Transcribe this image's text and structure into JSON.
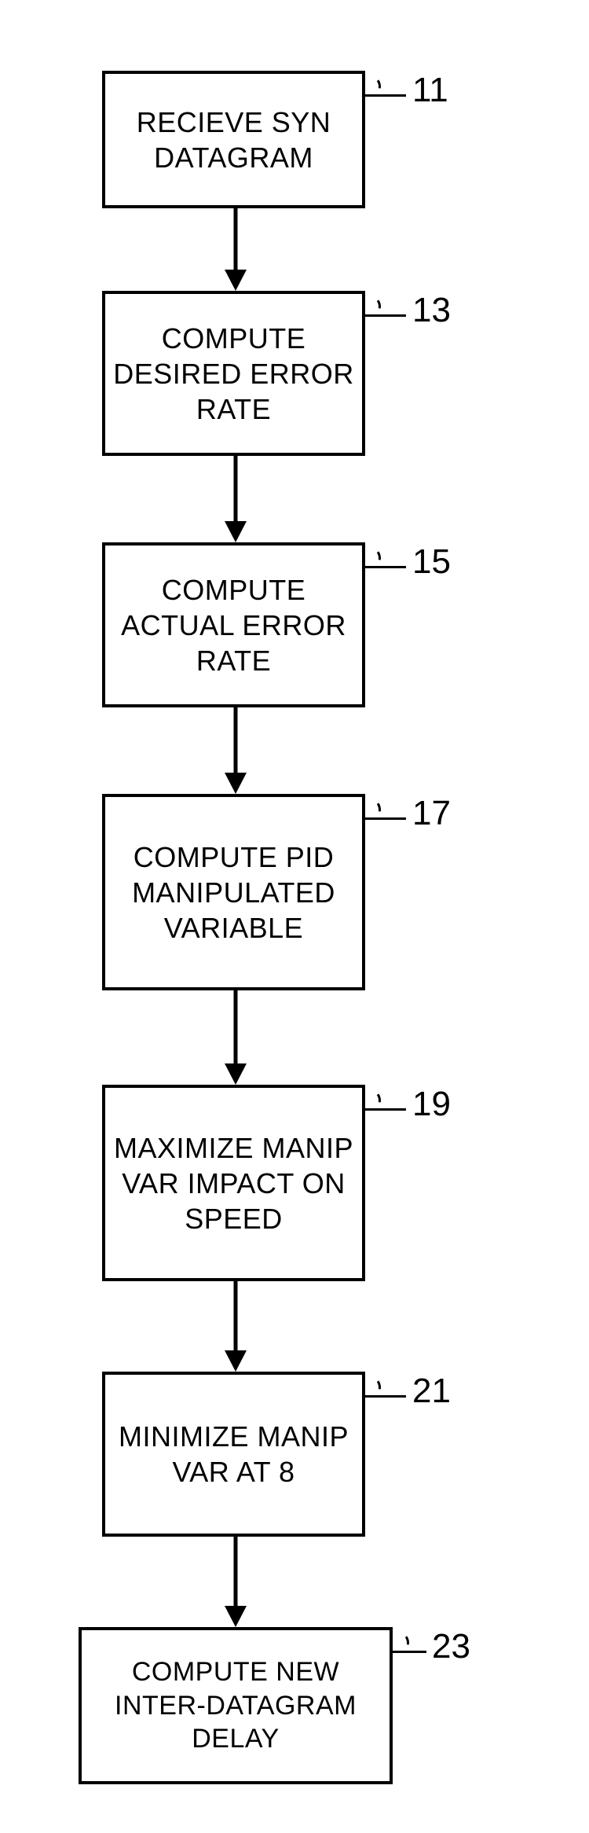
{
  "chart_data": {
    "type": "flowchart",
    "direction": "top-to-bottom",
    "nodes": [
      {
        "id": "n11",
        "ref": "11",
        "label": "RECIEVE SYN\nDATAGRAM"
      },
      {
        "id": "n13",
        "ref": "13",
        "label": "COMPUTE\nDESIRED\nERROR RATE"
      },
      {
        "id": "n15",
        "ref": "15",
        "label": "COMPUTE\nACTUAL\nERROR RATE"
      },
      {
        "id": "n17",
        "ref": "17",
        "label": "COMPUTE\nPID\nMANIPULATED\nVARIABLE"
      },
      {
        "id": "n19",
        "ref": "19",
        "label": "MAXIMIZE\nMANIP VAR\nIMPACT ON\nSPEED"
      },
      {
        "id": "n21",
        "ref": "21",
        "label": "MINIMIZE\nMANIP VAR\nAT 8"
      },
      {
        "id": "n23",
        "ref": "23",
        "label": "COMPUTE NEW\nINTER-DATAGRAM\nDELAY"
      }
    ],
    "edges": [
      {
        "from": "n11",
        "to": "n13"
      },
      {
        "from": "n13",
        "to": "n15"
      },
      {
        "from": "n15",
        "to": "n17"
      },
      {
        "from": "n17",
        "to": "n19"
      },
      {
        "from": "n19",
        "to": "n21"
      },
      {
        "from": "n21",
        "to": "n23"
      }
    ]
  },
  "nodes": {
    "n11": {
      "label": "RECIEVE SYN DATAGRAM",
      "ref": "11"
    },
    "n13": {
      "label": "COMPUTE DESIRED ERROR RATE",
      "ref": "13"
    },
    "n15": {
      "label": "COMPUTE ACTUAL ERROR RATE",
      "ref": "15"
    },
    "n17": {
      "label": "COMPUTE PID MANIPULATED VARIABLE",
      "ref": "17"
    },
    "n19": {
      "label": "MAXIMIZE MANIP VAR IMPACT ON SPEED",
      "ref": "19"
    },
    "n21": {
      "label": "MINIMIZE MANIP VAR AT 8",
      "ref": "21"
    },
    "n23": {
      "label": "COMPUTE NEW INTER-DATAGRAM DELAY",
      "ref": "23"
    }
  }
}
